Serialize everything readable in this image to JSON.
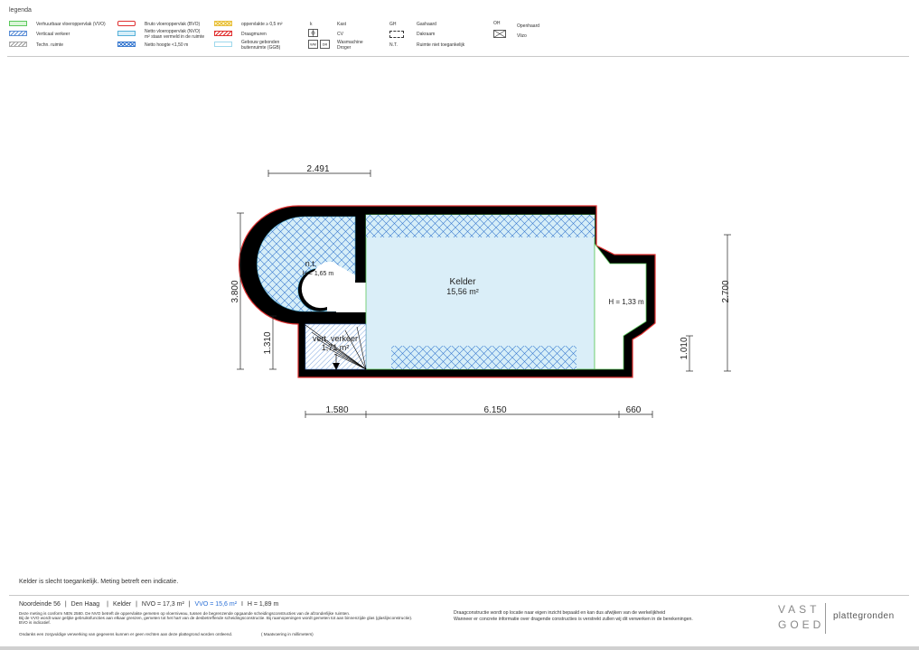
{
  "legend": {
    "title": "legenda",
    "col1": [
      {
        "label": "Verhuurbaar vloeroppervlak (VVO)",
        "style": "vvo"
      },
      {
        "label": "Verticaal verkeer",
        "style": "vertical"
      },
      {
        "label": "Techn. ruimte",
        "style": "techn"
      }
    ],
    "col2": [
      {
        "label": "Bruto vloeroppervlak (BVO)",
        "style": "bvo"
      },
      {
        "label": "Netto vloeroppervlak (NVO)",
        "label2": "m² staan vermeld in de ruimte",
        "style": "nvo"
      },
      {
        "label": "Netto hoogte <1,50 m",
        "style": "netto-hoogte"
      }
    ],
    "col3": [
      {
        "label": "oppervlakte ≥ 0,5 m²",
        "style": "opp"
      },
      {
        "label": "Draagmuren",
        "style": "draag"
      },
      {
        "label": "Gebouw gebonden",
        "label2": "buitenruimte (GGB)",
        "style": "ggb"
      }
    ],
    "col4": [
      {
        "symbol": "k",
        "label": "Kast"
      },
      {
        "symbol": "",
        "label": "CV"
      },
      {
        "symbol": "WM  DR",
        "label": "Wasmachine",
        "label2": "Droger"
      }
    ],
    "col5": [
      {
        "symbol": "GH",
        "label": "Gashaard"
      },
      {
        "symbol": "",
        "label": "Dakraam"
      },
      {
        "symbol": "N.T.",
        "label": "Ruimte niet toegankelijk"
      }
    ],
    "col6": [
      {
        "symbol": "OH",
        "label": "Openhaard"
      },
      {
        "symbol": "",
        "label": "Vlizo"
      }
    ],
    "symbols": {
      "wm": "WM",
      "dr": "DR"
    }
  },
  "colors": {
    "vvo_fill": "#daf5d8",
    "vvo_border": "#5cc85c",
    "vertical": "#5b8ed6",
    "bvo_border": "#e03030",
    "nvo_fill": "#d6eef8",
    "nvo_border": "#55b0d8",
    "hatch": "#3a7ad0",
    "opp": "#e8c040",
    "wall": "#000000",
    "room_fill": "#daeef8"
  },
  "plan": {
    "dims": {
      "top": "2.491",
      "left_total": "3.800",
      "left_lower": "1.310",
      "bottom_1": "1.580",
      "bottom_2": "6.150",
      "bottom_3": "660",
      "right_total": "2.700",
      "right_lower": "1.010"
    },
    "rooms": {
      "nt_label": "n.t.",
      "nt_height": "H = 1,65 m",
      "kelder_name": "Kelder",
      "kelder_area": "15,56 m²",
      "right_height": "H = 1,33 m",
      "vert_name": "vert. verkeer",
      "vert_area": "1,71 m²"
    }
  },
  "note": "Kelder is slecht toegankelijk. Meting betreft een indicatie.",
  "footer": {
    "address": "Noordeinde 56",
    "city": "Den Haag",
    "floor": "Kelder",
    "nvo": "NVO = 17,3 m²",
    "vvo": "VVO = 15,6 m²",
    "height": "H = 1,89 m",
    "sep": "|",
    "sep_short": "I",
    "disclaimer": [
      "Deze meting is conform NEN 2580. De NVO betreft de oppervlakte gemeten op vloerniveau, tussen de begrenzende opgaande scheidingsconstructies van de afzonderlijke ruimten.",
      "Bij de VVO wordt waar gelijke gebruiksfuncties aan elkaar grenzen, gemeten tot het hart van de desbetreffende scheidingsconstructie. Bij raamopeningen wordt gemeten tot aan binnenzijde glas (glaslijnconstructie).",
      "BVO is indicatief."
    ],
    "thanks": "Ondanks een zorgvuldige verwerking van gegevens kunnen er geen rechten aan deze plattegrond worden ontleend.",
    "measure": "( Maatvoering in millimeters)",
    "construction": [
      "Draagconstructie wordt op locatie naar eigen inzicht bepaald en kan dus afwijken van de werkelijkheid",
      "Wanneer er concrete informatie over dragende constructies is verstrekt zullen wij dit verwerken in de berekeningen."
    ],
    "brand_line1": "VAST",
    "brand_line2": "GOED",
    "brand_right": "plattegronden"
  }
}
